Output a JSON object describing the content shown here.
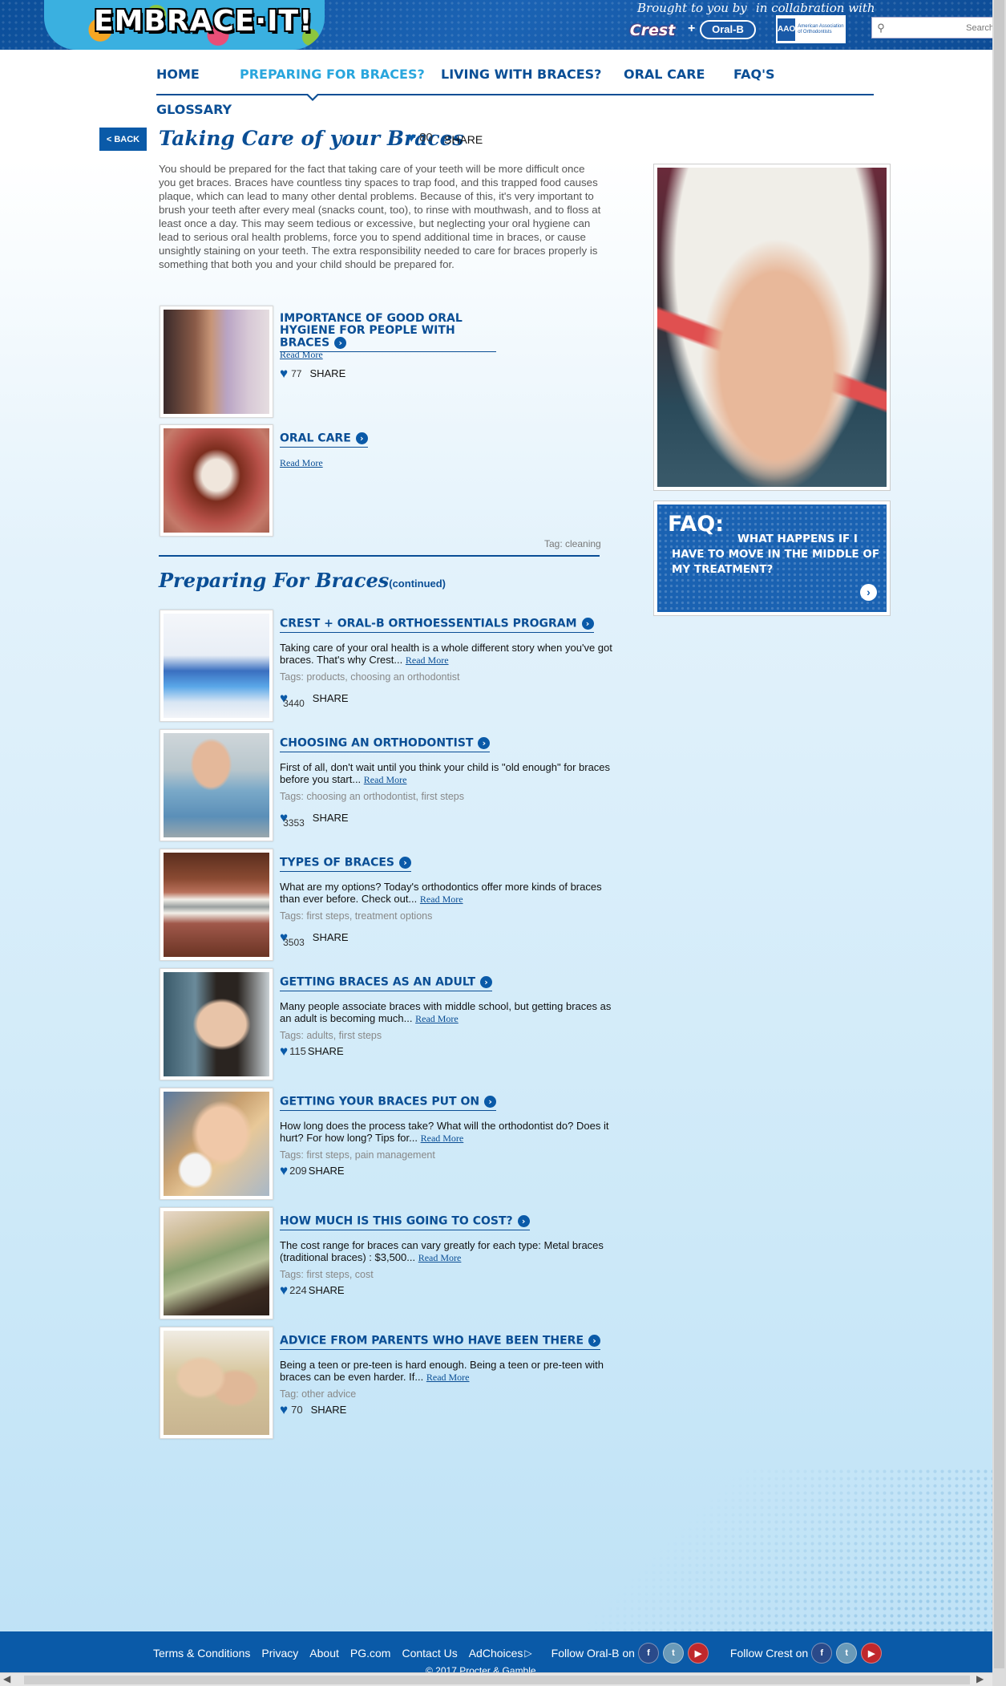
{
  "header": {
    "logo_text": "EMBRACE·IT!",
    "brought_by": "Brought to you by",
    "collab": "in collabration with",
    "crest": "Crest",
    "plus": "+",
    "oralb": "Oral-B",
    "aao_mark": "AAO",
    "aao_text": "American Association of Orthodontists",
    "search_placeholder": "Search"
  },
  "nav": {
    "items": [
      "HOME",
      "PREPARING FOR BRACES?",
      "LIVING WITH BRACES?",
      "ORAL CARE",
      "FAQ'S",
      "GLOSSARY"
    ],
    "active": "PREPARING FOR BRACES?"
  },
  "page": {
    "back": "< BACK",
    "title": "Taking Care of your Braces",
    "likes": "80",
    "share": "SHARE",
    "intro": "You should be prepared for the fact that taking care of your teeth will be more difficult once you get braces. Braces have countless tiny spaces to trap food, and this trapped food causes plaque, which can lead to many other dental problems. Because of this, it's very important to brush your teeth after every meal (snacks count, too), to rinse with mouthwash, and to floss at least once a day. This may seem tedious or excessive, but neglecting your oral hygiene can lead to serious oral health problems, force you to spend additional time in braces, or cause unsightly staining on your teeth. The extra responsibility needed to care for braces properly is something that both you and your child should be prepared for.",
    "tag_line": "Tag: cleaning"
  },
  "related": [
    {
      "title": "IMPORTANCE OF GOOD ORAL HYGIENE FOR PEOPLE WITH BRACES",
      "read_more": "Read More",
      "likes": "77",
      "share": "SHARE"
    },
    {
      "title": "ORAL CARE",
      "read_more": "Read More"
    }
  ],
  "section": {
    "title": "Preparing For Braces",
    "continued": "(continued)"
  },
  "articles": [
    {
      "title": "CREST + ORAL-B ORTHOESSENTIALS PROGRAM",
      "desc": "Taking care of your oral health is a whole different story when you've got braces. That's why Crest...",
      "read_more": "Read More",
      "tags": "Tags: products, choosing an orthodontist",
      "likes": "3440",
      "share": "SHARE"
    },
    {
      "title": "CHOOSING AN ORTHODONTIST",
      "desc": "First of all, don't wait until you think your child is \"old enough\" for braces before you start...",
      "read_more": "Read More",
      "tags": "Tags: choosing an orthodontist, first steps",
      "likes": "3353",
      "share": "SHARE"
    },
    {
      "title": "TYPES OF BRACES",
      "desc": "What are my options? Today's orthodontics offer more kinds of braces than ever before. Check out...",
      "read_more": "Read More",
      "tags": "Tags: first steps, treatment options",
      "likes": "3503",
      "share": "SHARE"
    },
    {
      "title": "GETTING BRACES AS AN ADULT",
      "desc": "Many people associate braces with middle school, but getting braces as an adult is becoming much...",
      "read_more": "Read More",
      "tags": "Tags: adults, first steps",
      "likes": "115",
      "share": "SHARE"
    },
    {
      "title": "GETTING YOUR BRACES PUT ON",
      "desc": "How long does the process take? What will the orthodontist do? Does it hurt? For how long? Tips for...",
      "read_more": "Read More",
      "tags": "Tags: first steps, pain management",
      "likes": "209",
      "share": "SHARE"
    },
    {
      "title": "HOW MUCH IS THIS GOING TO COST?",
      "desc": "The cost range for braces can vary greatly for each type: Metal braces (traditional braces) : $3,500...",
      "read_more": "Read More",
      "tags": "Tags: first steps, cost",
      "likes": "224",
      "share": "SHARE"
    },
    {
      "title": "ADVICE FROM PARENTS WHO HAVE BEEN THERE",
      "desc": "Being a teen or pre-teen is hard enough. Being a teen or pre-teen with braces can be even harder. If...",
      "read_more": "Read More",
      "tags": "Tag: other advice",
      "likes": "70",
      "share": "SHARE"
    }
  ],
  "sidebar": {
    "faq_label": "FAQ:",
    "faq_question": "WHAT HAPPENS IF I HAVE TO MOVE IN THE MIDDLE OF MY TREATMENT?"
  },
  "footer": {
    "links": [
      "Terms & Conditions",
      "Privacy",
      "About",
      "PG.com",
      "Contact Us",
      "AdChoices"
    ],
    "follow_oralb": "Follow Oral-B on",
    "follow_crest": "Follow Crest on",
    "copyright": "© 2017 Procter & Gamble"
  },
  "colors": {
    "brand_blue": "#0a4e95",
    "active_nav": "#29a6dd",
    "footer_blue": "#0a5aa8"
  }
}
